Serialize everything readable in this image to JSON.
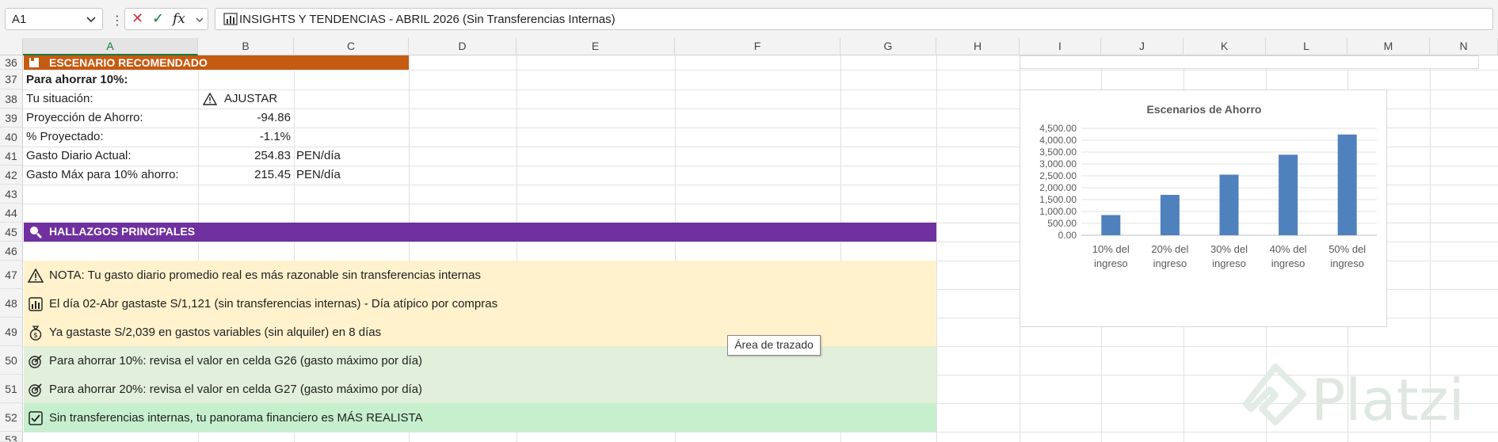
{
  "formula_bar": {
    "name_box": "A1",
    "fx_label": "fx",
    "formula_text": "INSIGHTS Y TENDENCIAS - ABRIL 2026 (Sin Transferencias Internas)"
  },
  "columns": [
    "A",
    "B",
    "C",
    "D",
    "E",
    "F",
    "G",
    "H",
    "I",
    "J",
    "K",
    "L",
    "M",
    "N"
  ],
  "rows": [
    "36",
    "37",
    "38",
    "39",
    "40",
    "41",
    "42",
    "43",
    "44",
    "45",
    "46",
    "47",
    "48",
    "49",
    "50",
    "51",
    "52",
    "53"
  ],
  "section_escenario": {
    "title": "ESCENARIO RECOMENDADO",
    "subtitle": "Para ahorrar 10%:",
    "situacion_label": "Tu situación:",
    "situacion_value": "AJUSTAR",
    "proyeccion_label": "Proyección de Ahorro:",
    "proyeccion_value": "-94.86",
    "porcentaje_label": "% Proyectado:",
    "porcentaje_value": "-1.1%",
    "gasto_diario_label": "Gasto Diario Actual:",
    "gasto_diario_value": "254.83",
    "gasto_diario_unit": "PEN/día",
    "gasto_max_label": "Gasto Máx para 10% ahorro:",
    "gasto_max_value": "215.45",
    "gasto_max_unit": "PEN/día"
  },
  "section_hallazgos": {
    "title": "HALLAZGOS PRINCIPALES",
    "items": [
      "NOTA: Tu gasto diario promedio real es más razonable sin transferencias internas",
      "El día 02-Abr gastaste S/1,121 (sin transferencias internas) - Día atípico por compras",
      "Ya gastaste S/2,039 en gastos variables (sin alquiler) en 8 días",
      "Para ahorrar 10%: revisa el valor en celda G26 (gasto máximo por día)",
      "Para ahorrar 20%: revisa el valor en celda G27 (gasto máximo por día)",
      "Sin transferencias internas, tu panorama financiero es MÁS REALISTA"
    ]
  },
  "colors": {
    "escenario_header": "#c55a11",
    "hallazgos_header": "#7030a0",
    "warning_band": "#fff2cc",
    "info_band": "#e2efda",
    "success_band": "#c6efce",
    "bar": "#4f81bd",
    "excel_green": "#107c41"
  },
  "chart_data": {
    "type": "bar",
    "title": "Escenarios de Ahorro",
    "categories": [
      [
        "10% del",
        "ingreso"
      ],
      [
        "20% del",
        "ingreso"
      ],
      [
        "30% del",
        "ingreso"
      ],
      [
        "40% del",
        "ingreso"
      ],
      [
        "50% del",
        "ingreso"
      ]
    ],
    "values": [
      850,
      1700,
      2550,
      3390,
      4240
    ],
    "ylim": [
      0,
      4500
    ],
    "yticks": [
      "0.00",
      "500.00",
      "1,000.00",
      "1,500.00",
      "2,000.00",
      "2,500.00",
      "3,000.00",
      "3,500.00",
      "4,000.00",
      "4,500.00"
    ],
    "grid": true
  },
  "tooltip": "Área de trazado",
  "watermark": "Platzi"
}
